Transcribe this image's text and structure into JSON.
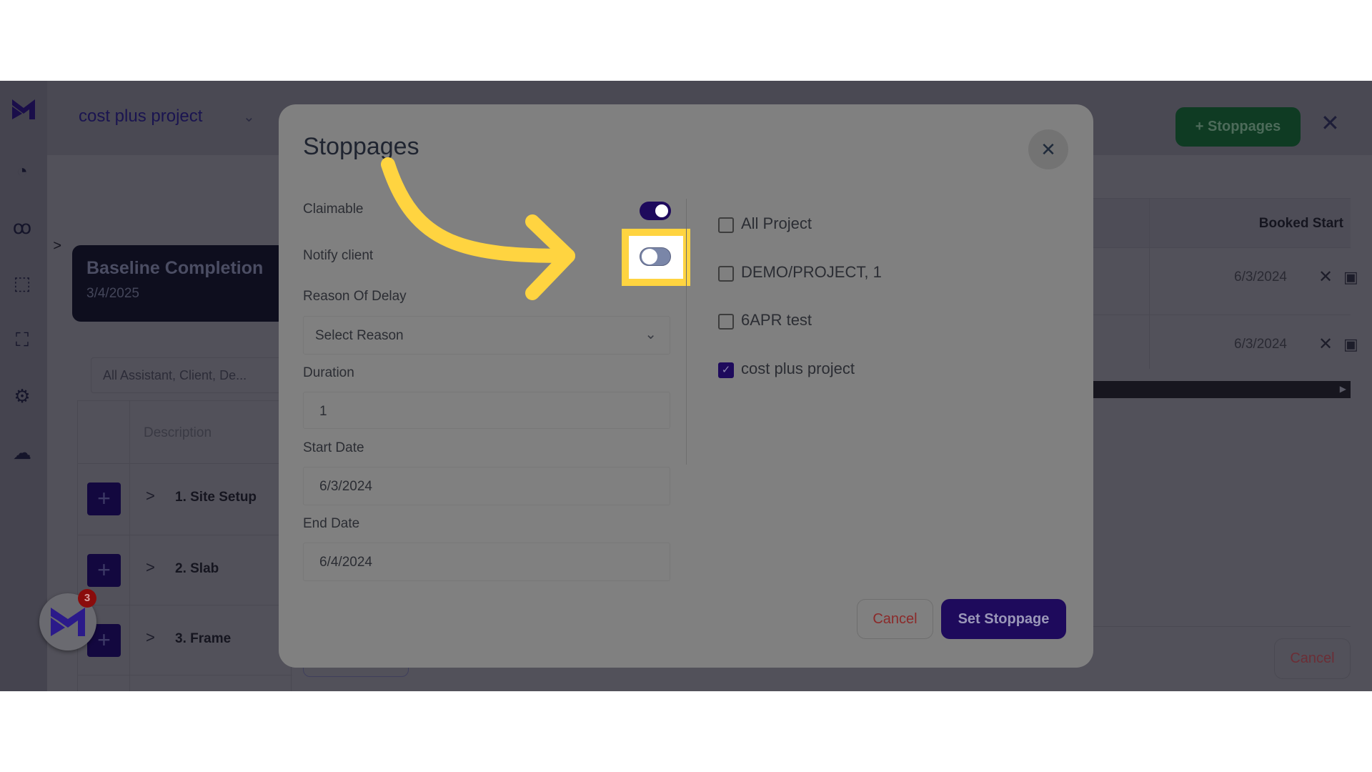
{
  "app": {
    "project_selector": "cost plus project",
    "sidebar_icons": [
      "dashboard-icon",
      "team-icon",
      "chart-icon",
      "presentation-icon",
      "settings-icon",
      "cloud-network-icon"
    ],
    "baseline_card": {
      "title": "Baseline Completion",
      "date": "3/4/2025"
    },
    "filter": "All Assistant, Client, De...",
    "table": {
      "header_description": "Description",
      "header_booked_start": "Booked Start",
      "rows": [
        {
          "label": "1. Site Setup",
          "booked_start": "6/3/2024"
        },
        {
          "label": "2. Slab",
          "booked_start": "6/3/2024"
        },
        {
          "label": "3. Frame"
        }
      ]
    },
    "stoppages_button": "Stoppages",
    "cancel_button": "Cancel",
    "notification_badge": "3"
  },
  "modal": {
    "title": "Stoppages",
    "claimable": {
      "label": "Claimable",
      "on": true
    },
    "notify_client": {
      "label": "Notify client",
      "on": false
    },
    "reason": {
      "label": "Reason Of Delay",
      "value": "Select Reason"
    },
    "duration": {
      "label": "Duration",
      "value": "1"
    },
    "start_date": {
      "label": "Start Date",
      "value": "6/3/2024"
    },
    "end_date": {
      "label": "End Date",
      "value": "6/4/2024"
    },
    "projects": [
      {
        "label": "All Project",
        "checked": false
      },
      {
        "label": "DEMO/PROJECT, 1",
        "checked": false
      },
      {
        "label": "6APR test",
        "checked": false
      },
      {
        "label": "cost plus project",
        "checked": true
      }
    ],
    "cancel": "Cancel",
    "submit": "Set Stoppage"
  },
  "colors": {
    "accent": "#1e0a5c",
    "highlight": "#ffd440",
    "green": "#0f3b23",
    "danger": "#8b2a2a"
  }
}
